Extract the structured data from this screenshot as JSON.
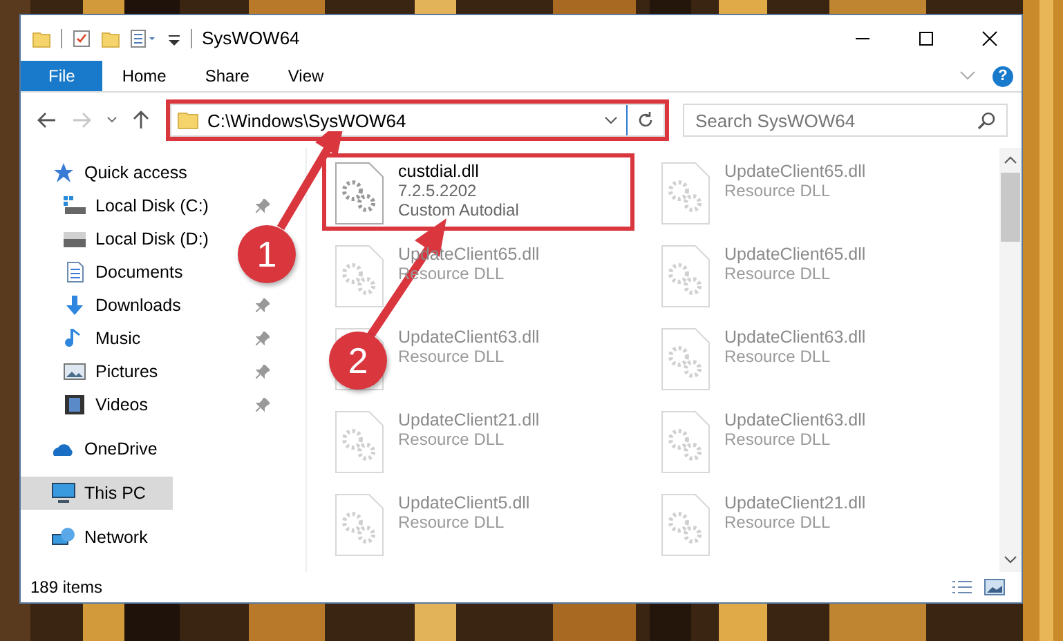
{
  "window": {
    "title": "SysWOW64"
  },
  "ribbon": {
    "tabs": [
      {
        "label": "File",
        "selected": true
      },
      {
        "label": "Home",
        "selected": false
      },
      {
        "label": "Share",
        "selected": false
      },
      {
        "label": "View",
        "selected": false
      }
    ],
    "help": "?"
  },
  "address_bar": {
    "path": "C:\\Windows\\SysWOW64",
    "highlighted": true
  },
  "search": {
    "placeholder": "Search SysWOW64"
  },
  "sidebar": {
    "items": [
      {
        "label": "Quick access",
        "kind": "star",
        "selected": false,
        "children": [
          {
            "label": "Local Disk (C:)",
            "kind": "system-drive",
            "pinned": true,
            "selected": false
          },
          {
            "label": "Local Disk (D:)",
            "kind": "drive",
            "selected": false
          },
          {
            "label": "Documents",
            "kind": "documents",
            "selected": false
          },
          {
            "label": "Downloads",
            "kind": "downloads",
            "pinned": true,
            "selected": false
          },
          {
            "label": "Music",
            "kind": "music",
            "pinned": true,
            "selected": false
          },
          {
            "label": "Pictures",
            "kind": "pictures",
            "pinned": true,
            "selected": false
          },
          {
            "label": "Videos",
            "kind": "videos",
            "pinned": true,
            "selected": false
          }
        ]
      },
      {
        "label": "OneDrive",
        "kind": "cloud",
        "selected": false
      },
      {
        "label": "This PC",
        "kind": "pc",
        "selected": true
      },
      {
        "label": "Network",
        "kind": "network",
        "selected": false
      }
    ]
  },
  "files": [
    {
      "name": "custdial.dll",
      "details": [
        "7.2.5.2202",
        "Custom Autodial"
      ],
      "faded": false,
      "highlighted": true
    },
    {
      "name": "UpdateClient65.dll",
      "details": [
        "Resource DLL"
      ],
      "faded": true,
      "highlighted": false
    },
    {
      "name": "UpdateClient63.dll",
      "details": [
        "Resource DLL"
      ],
      "faded": true,
      "highlighted": false
    },
    {
      "name": "UpdateClient21.dll",
      "details": [
        "Resource DLL"
      ],
      "faded": true,
      "highlighted": false
    },
    {
      "name": "UpdateClient5.dll",
      "details": [
        "Resource DLL"
      ],
      "faded": true,
      "highlighted": false
    },
    {
      "name": "UpdateClient65.dll",
      "details": [
        "Resource DLL"
      ],
      "faded": true,
      "highlighted": false
    },
    {
      "name": "UpdateClient65.dll",
      "details": [
        "Resource DLL"
      ],
      "faded": true,
      "highlighted": false
    },
    {
      "name": "UpdateClient63.dll",
      "details": [
        "Resource DLL"
      ],
      "faded": true,
      "highlighted": false
    },
    {
      "name": "UpdateClient63.dll",
      "details": [
        "Resource DLL"
      ],
      "faded": true,
      "highlighted": false
    },
    {
      "name": "UpdateClient21.dll",
      "details": [
        "Resource DLL"
      ],
      "faded": true,
      "highlighted": false
    }
  ],
  "status_bar": {
    "count": "189 items"
  },
  "annotations": [
    {
      "label": "1"
    },
    {
      "label": "2"
    }
  ]
}
